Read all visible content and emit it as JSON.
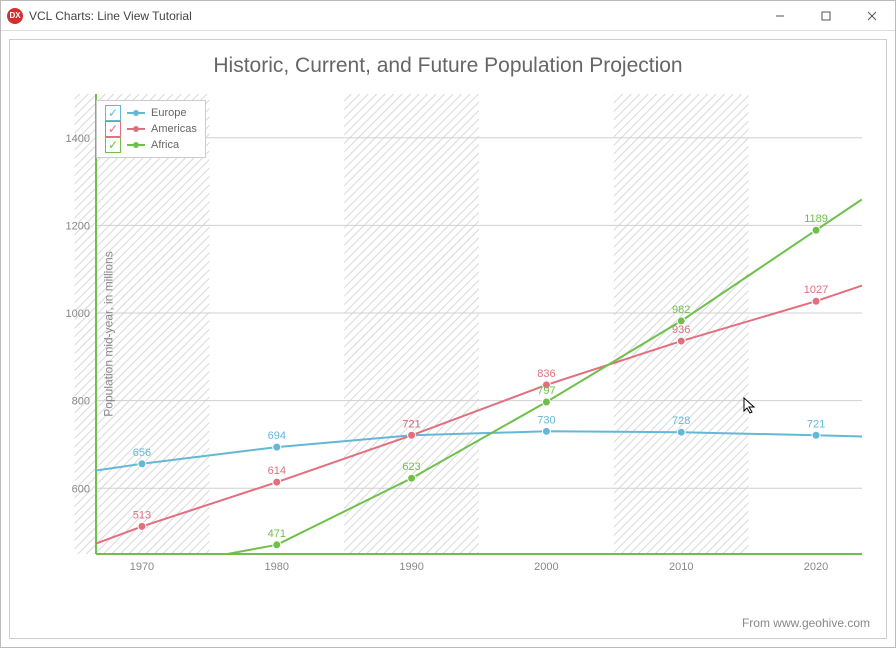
{
  "window": {
    "title": "VCL Charts: Line View Tutorial"
  },
  "chart": {
    "title": "Historic, Current, and Future Population Projection",
    "ylabel": "Population mid-year, in millions",
    "footer": "From www.geohive.com"
  },
  "legend": {
    "items": [
      {
        "label": "Europe",
        "color": "#63b8d6"
      },
      {
        "label": "Americas",
        "color": "#e26f7e"
      },
      {
        "label": "Africa",
        "color": "#6fbf4b"
      }
    ]
  },
  "chart_data": {
    "type": "line",
    "categories": [
      1970,
      1980,
      1990,
      2000,
      2010,
      2020
    ],
    "series": [
      {
        "name": "Europe",
        "color": "#63b8d6",
        "values": [
          656,
          694,
          721,
          730,
          728,
          721
        ]
      },
      {
        "name": "Americas",
        "color": "#e26f7e",
        "values": [
          513,
          614,
          721,
          836,
          936,
          1027
        ]
      },
      {
        "name": "Africa",
        "color": "#6fbf4b",
        "values": [
          null,
          471,
          623,
          797,
          982,
          1189
        ]
      }
    ],
    "xlabel": "",
    "ylabel": "Population mid-year, in millions",
    "ylim": [
      450,
      1500
    ],
    "yticks": [
      600,
      800,
      1000,
      1200,
      1400
    ],
    "title": "Historic, Current, and Future Population Projection"
  }
}
